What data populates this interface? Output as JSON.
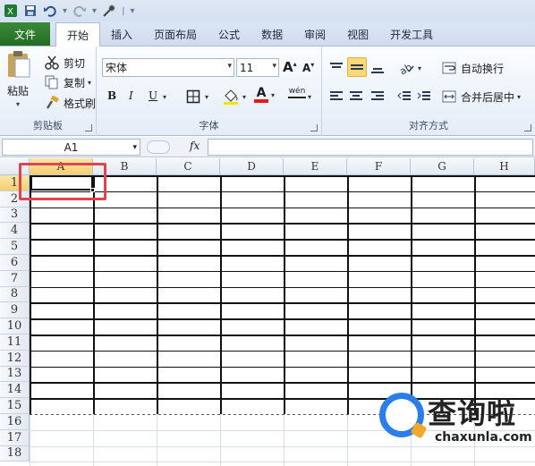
{
  "ribbon_tabs": [
    "文件",
    "开始",
    "插入",
    "页面布局",
    "公式",
    "数据",
    "审阅",
    "视图",
    "开发工具"
  ],
  "clipboard": {
    "paste_label": "粘贴",
    "cut_label": "剪切",
    "copy_label": "复制",
    "format_painter_label": "格式刷",
    "group_label": "剪贴板"
  },
  "font": {
    "font_name": "宋体",
    "font_size": "11",
    "bold": "B",
    "italic": "I",
    "underline": "U",
    "font_color_glyph": "A",
    "wen_glyph": "wén",
    "group_label": "字体"
  },
  "alignment": {
    "wrap_text_label": "自动换行",
    "merge_center_label": "合并后居中",
    "group_label": "对齐方式"
  },
  "formula_bar": {
    "name_box": "A1",
    "fx": "fx",
    "value": ""
  },
  "sheet": {
    "columns": [
      "A",
      "B",
      "C",
      "D",
      "E",
      "F",
      "G",
      "H"
    ],
    "rows": [
      "1",
      "2",
      "3",
      "4",
      "5",
      "6",
      "7",
      "8",
      "9",
      "10",
      "11",
      "12",
      "13",
      "14",
      "15",
      "16",
      "17",
      "18"
    ],
    "selected_cell": "A1"
  },
  "watermark": {
    "title": "查询啦",
    "url": "chaxunla.com"
  },
  "colors": {
    "file_tab": "#2f7d2f",
    "selection_header": "#f5cf70",
    "highlight_box": "#e0454f",
    "watermark_blue": "#2b7de9"
  }
}
